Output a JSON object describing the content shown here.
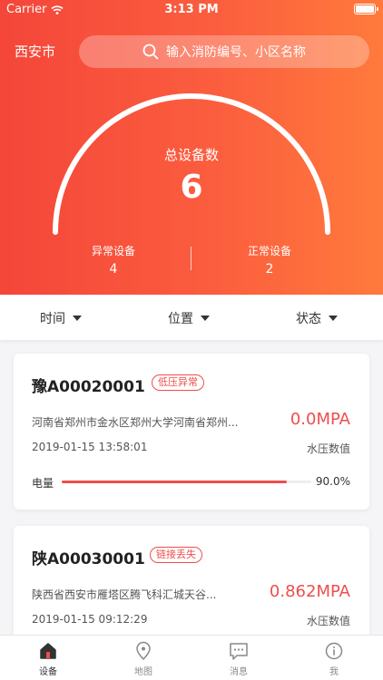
{
  "status_bar": {
    "carrier": "Carrier",
    "time": "3:13 PM"
  },
  "header": {
    "city": "西安市",
    "search_placeholder": "输入消防编号、小区名称"
  },
  "summary": {
    "total_label": "总设备数",
    "total_value": "6",
    "abnormal_label": "异常设备",
    "abnormal_value": "4",
    "normal_label": "正常设备",
    "normal_value": "2"
  },
  "filters": {
    "time": "时间",
    "location": "位置",
    "status": "状态"
  },
  "devices": [
    {
      "id": "豫A00020001",
      "tag": "低压异常",
      "address": "河南省郑州市金水区郑州大学河南省郑州...",
      "pressure": "0.0MPA",
      "date": "2019-01-15 13:58:01",
      "pressure_label": "水压数值",
      "battery_label": "电量",
      "battery_value": "90.0%",
      "battery_level": 0.9
    },
    {
      "id": "陕A00030001",
      "tag": "链接丢失",
      "address": "陕西省西安市雁塔区腾飞科汇城天谷...",
      "pressure": "0.862MPA",
      "date": "2019-01-15 09:12:29",
      "pressure_label": "水压数值"
    }
  ],
  "tabs": [
    {
      "label": "设备",
      "icon": "home-icon",
      "active": true
    },
    {
      "label": "地图",
      "icon": "location-pin-icon"
    },
    {
      "label": "消息",
      "icon": "message-icon"
    },
    {
      "label": "我",
      "icon": "profile-icon"
    }
  ],
  "colors": {
    "accent": "#ef4d4d",
    "gradient_start": "#f4463a",
    "gradient_end": "#ff7a3c"
  }
}
